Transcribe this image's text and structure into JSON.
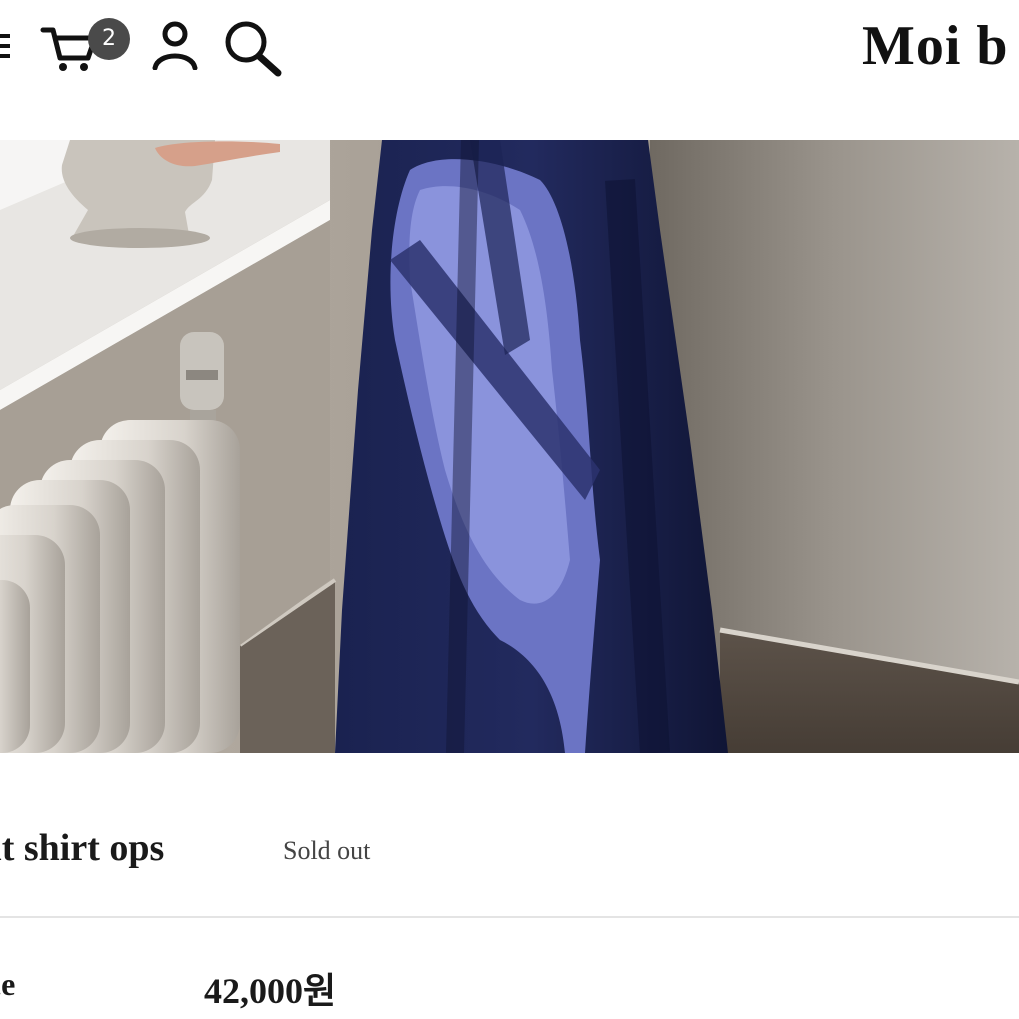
{
  "header": {
    "brand": "Moi b",
    "cart_count": "2",
    "icons": [
      "menu-icon",
      "cart-icon",
      "user-icon",
      "search-icon"
    ]
  },
  "product": {
    "name": "nit shirt ops",
    "status": "Sold out",
    "price_label": "ice",
    "price": "42,000원"
  },
  "colors": {
    "text": "#111111",
    "badge": "#4a4a4a",
    "divider": "#e4e4e4",
    "dress": "#1b2550",
    "wall": "#8c847b"
  }
}
